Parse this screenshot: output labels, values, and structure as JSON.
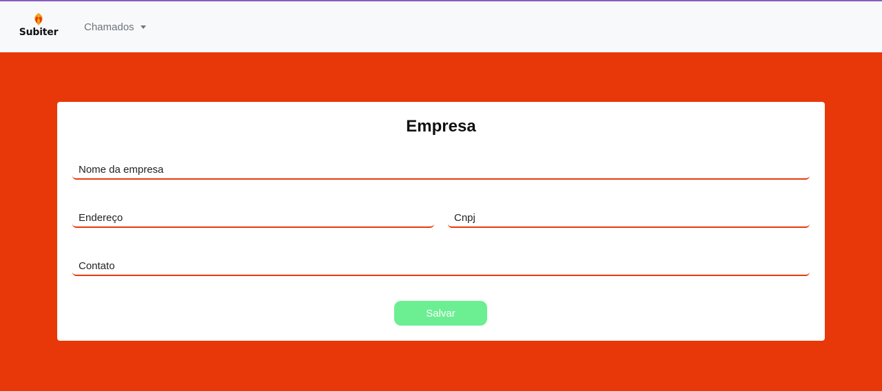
{
  "navbar": {
    "brand_name": "Subiter",
    "dropdown_label": "Chamados"
  },
  "form": {
    "title": "Empresa",
    "fields": {
      "nome": {
        "placeholder": "Nome da empresa",
        "value": ""
      },
      "endereco": {
        "placeholder": "Endereço",
        "value": ""
      },
      "cnpj": {
        "placeholder": "Cnpj",
        "value": ""
      },
      "contato": {
        "placeholder": "Contato",
        "value": ""
      }
    },
    "submit_label": "Salvar"
  },
  "icons": {
    "brand": "flame-logo-icon",
    "dropdown": "caret-down-icon"
  },
  "colors": {
    "background": "#e8380a",
    "navbar": "#f8f9fa",
    "accent_line": "#8a5bbf",
    "field_underline": "#e8380a",
    "save_button": "#6cee92",
    "nav_text": "#6c757d"
  }
}
